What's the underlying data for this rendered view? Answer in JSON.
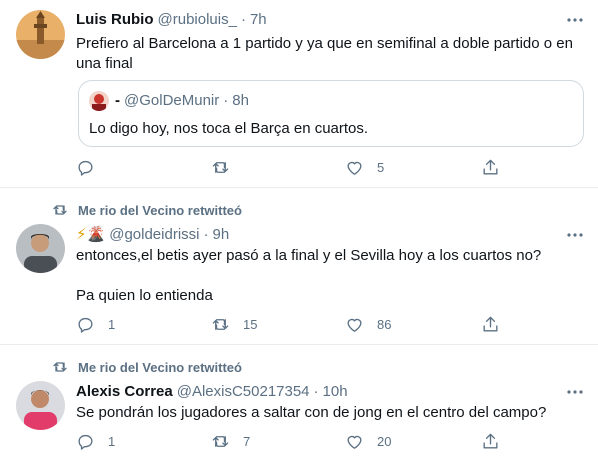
{
  "tweets": [
    {
      "name": "Luis Rubio",
      "handle": "@rubioluis_",
      "sep": "·",
      "time": "7h",
      "text_lines": [
        "Prefiero al Barcelona a 1 partido y ya que en semifinal a doble partido o en",
        "una final"
      ],
      "quote": {
        "name": "-",
        "handle": "@GolDeMunir",
        "sep": "·",
        "time": "8h",
        "text": "Lo digo hoy, nos toca el Barça en cuartos."
      },
      "actions": {
        "reply": "",
        "retweet": "",
        "like": "5",
        "share": ""
      }
    },
    {
      "retweeted_by": "Me rio del Vecino retwitteó",
      "name_emoji": "⚡🌋",
      "handle": "@goldeidrissi",
      "sep": "·",
      "time": "9h",
      "text_lines": [
        "entonces,el betis ayer pasó a la final y el Sevilla hoy a los cuartos no?",
        "",
        "Pa quien lo entienda"
      ],
      "actions": {
        "reply": "1",
        "retweet": "15",
        "like": "86",
        "share": ""
      }
    },
    {
      "retweeted_by": "Me rio del Vecino retwitteó",
      "name": "Alexis Correa",
      "handle": "@AlexisC50217354",
      "sep": "·",
      "time": "10h",
      "text_lines": [
        "Se pondrán los jugadores a saltar con de jong en el centro del campo?"
      ],
      "actions": {
        "reply": "1",
        "retweet": "7",
        "like": "20",
        "share": ""
      }
    }
  ],
  "colors": {
    "secondary": "#5b7083",
    "primary": "#0f1419",
    "border": "#ebeef0"
  },
  "icons": [
    "more-icon",
    "reply-icon",
    "retweet-icon",
    "like-icon",
    "share-icon"
  ]
}
